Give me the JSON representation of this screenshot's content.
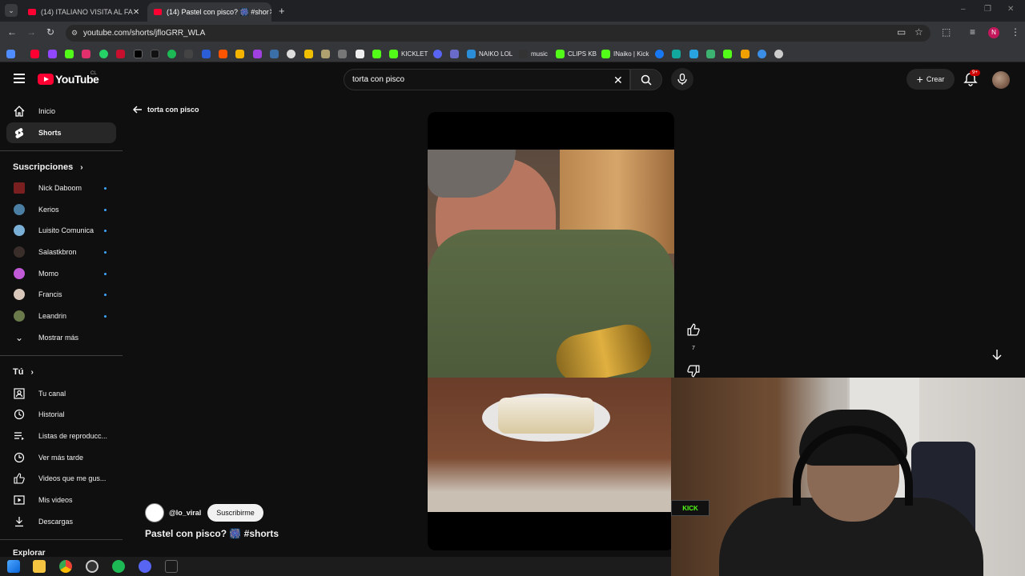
{
  "browser": {
    "tabs": [
      {
        "label": "(14) ITALIANO VISITA AL FA"
      },
      {
        "label": "(14) Pastel con pisco? 🎆 #shor"
      }
    ],
    "url": "youtube.com/shorts/jfloGRR_WLA",
    "bookmarks": [
      "KICKLET",
      "NAIKO LOL",
      "music",
      "CLIPS KB",
      "INaiko | Kick"
    ],
    "profile_initial": "N"
  },
  "header": {
    "logo": "YouTube",
    "country_code": "CL",
    "search_value": "torta con pisco",
    "create_label": "Crear",
    "notif_count": "9+"
  },
  "sidebar": {
    "main": [
      {
        "label": "Inicio",
        "icon": "home-icon"
      },
      {
        "label": "Shorts",
        "icon": "shorts-icon"
      }
    ],
    "subs_title": "Suscripciones",
    "subscriptions": [
      {
        "label": "Nick Daboom",
        "color": "#7a1f1f"
      },
      {
        "label": "Kerios",
        "color": "#4a7fa3"
      },
      {
        "label": "Luisito Comunica",
        "color": "#7ab0d6"
      },
      {
        "label": "Salastkbron",
        "color": "#3a2e2a"
      },
      {
        "label": "Momo",
        "color": "#c05ad6"
      },
      {
        "label": "Francis",
        "color": "#d9c8b9"
      },
      {
        "label": "Leandrin",
        "color": "#6a7a4a"
      }
    ],
    "show_more": "Mostrar más",
    "you_title": "Tú",
    "you_items": [
      {
        "label": "Tu canal",
        "icon": "channel-icon"
      },
      {
        "label": "Historial",
        "icon": "history-icon"
      },
      {
        "label": "Listas de reproducc...",
        "icon": "playlist-icon"
      },
      {
        "label": "Ver más tarde",
        "icon": "clock-icon"
      },
      {
        "label": "Videos que me gus...",
        "icon": "like-icon"
      },
      {
        "label": "Mis videos",
        "icon": "video-icon"
      },
      {
        "label": "Descargas",
        "icon": "download-icon"
      }
    ],
    "explore_title": "Explorar"
  },
  "main": {
    "back_label": "torta con pisco",
    "channel": "@lo_viral",
    "subscribe": "Suscribirme",
    "title": "Pastel con pisco? 🎆 #shorts",
    "likes": "7"
  },
  "overlay": {
    "kick_text": "KICK"
  },
  "colors": {
    "accent": "#ff0033",
    "link": "#3ea6ff",
    "bg": "#0f0f0f"
  }
}
